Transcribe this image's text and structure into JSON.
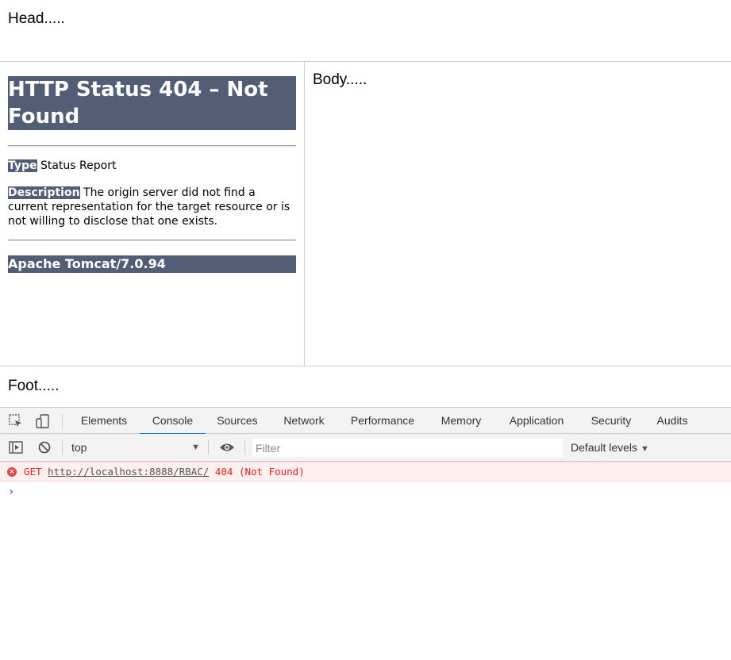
{
  "frames": {
    "head_text": "Head.....",
    "body_text": "Body.....",
    "foot_text": "Foot....."
  },
  "error_page": {
    "title": "HTTP Status 404 – Not Found",
    "type_label": "Type",
    "type_value": " Status Report",
    "description_label": "Description",
    "description_value": " The origin server did not find a current representation for the target resource or is not willing to disclose that one exists.",
    "server": "Apache Tomcat/7.0.94"
  },
  "devtools": {
    "tabs": [
      "Elements",
      "Console",
      "Sources",
      "Network",
      "Performance",
      "Memory",
      "Application",
      "Security",
      "Audits"
    ],
    "active_tab": "Console",
    "context": "top",
    "filter_placeholder": "Filter",
    "levels": "Default levels",
    "console_error": {
      "method": "GET",
      "url": "http://localhost:8888/RBAC/",
      "status": "404 (Not Found)"
    },
    "prompt": "›"
  }
}
